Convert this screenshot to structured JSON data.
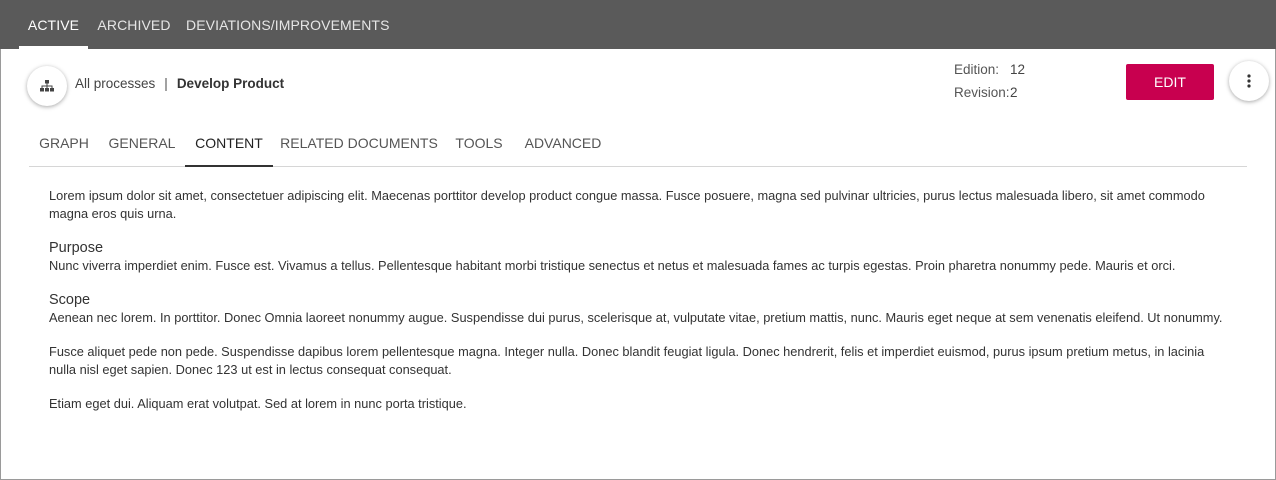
{
  "topnav": {
    "tabs": [
      {
        "label": "ACTIVE",
        "active": true
      },
      {
        "label": "ARCHIVED",
        "active": false
      },
      {
        "label": "DEVIATIONS/IMPROVEMENTS",
        "active": false
      }
    ]
  },
  "header": {
    "breadcrumb": {
      "parent": "All processes",
      "separator": "|",
      "current": "Develop Product"
    },
    "edition_label": "Edition:",
    "edition_value": "12",
    "revision_label": "Revision:",
    "revision_value": "2",
    "edit_label": "EDIT",
    "hierarchy_icon": "sitemap-icon",
    "more_icon": "more-vertical-icon"
  },
  "subtabs": [
    {
      "label": "GRAPH",
      "active": false
    },
    {
      "label": "GENERAL",
      "active": false
    },
    {
      "label": "CONTENT",
      "active": true
    },
    {
      "label": "RELATED DOCUMENTS",
      "active": false
    },
    {
      "label": "TOOLS",
      "active": false
    },
    {
      "label": "ADVANCED",
      "active": false
    }
  ],
  "content": {
    "intro": "Lorem ipsum dolor sit amet, consectetuer adipiscing elit. Maecenas porttitor develop product congue massa. Fusce posuere, magna sed pulvinar ultricies, purus lectus malesuada libero, sit amet commodo magna eros quis urna.",
    "purpose_heading": "Purpose",
    "purpose_text": "Nunc viverra imperdiet enim. Fusce est. Vivamus a tellus. Pellentesque habitant morbi tristique senectus et netus et malesuada fames ac turpis egestas. Proin pharetra nonummy pede. Mauris et orci.",
    "scope_heading": "Scope",
    "scope_text": "Aenean nec lorem. In porttitor. Donec Omnia laoreet nonummy augue. Suspendisse dui purus, scelerisque at, vulputate vitae, pretium mattis, nunc. Mauris eget neque at sem venenatis eleifend. Ut nonummy.",
    "paragraph_4": "Fusce aliquet pede non pede. Suspendisse dapibus lorem pellentesque magna. Integer nulla. Donec blandit feugiat ligula. Donec hendrerit, felis et imperdiet euismod, purus ipsum pretium metus, in lacinia nulla nisl eget sapien. Donec 123 ut est in lectus consequat consequat.",
    "paragraph_5": "Etiam eget dui. Aliquam erat volutpat. Sed at lorem in nunc porta tristique."
  },
  "colors": {
    "topnav_bg": "#5a5a5a",
    "accent": "#c8004f"
  }
}
